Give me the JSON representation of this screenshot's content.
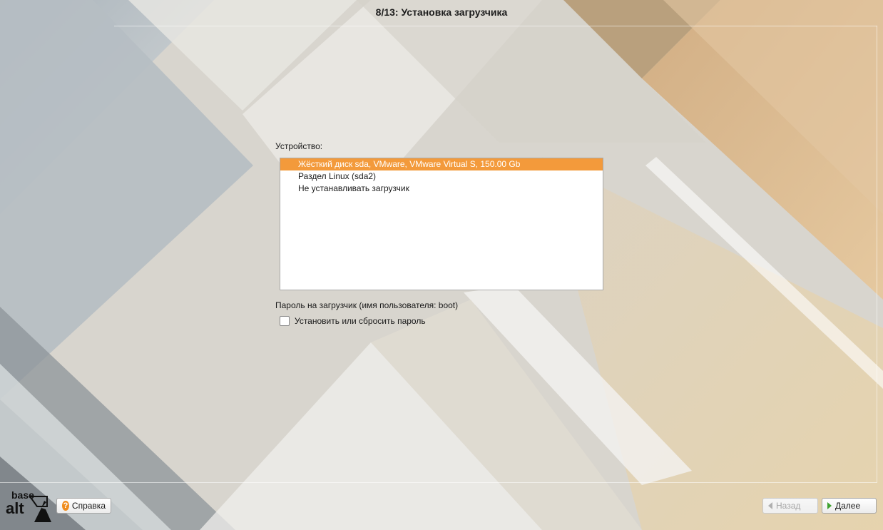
{
  "window": {
    "title": "8/13: Установка загрузчика"
  },
  "device": {
    "label": "Устройство:",
    "items": [
      {
        "label": "Жёсткий диск sda, VMware, VMware Virtual S, 150.00 Gb",
        "selected": true
      },
      {
        "label": "Раздел Linux (sda2)",
        "selected": false
      },
      {
        "label": "Не устанавливать загрузчик",
        "selected": false
      }
    ]
  },
  "password": {
    "label": "Пароль на загрузчик (имя пользователя: boot)",
    "checkbox_label": "Установить или сбросить пароль",
    "checked": false
  },
  "footer": {
    "logo_top": "base",
    "logo_bottom": "alt",
    "help_label": "Справка",
    "back_label": "Назад",
    "next_label": "Далее",
    "icons": {
      "help": "question-icon",
      "back": "arrow-left-icon",
      "next": "arrow-right-icon"
    }
  },
  "colors": {
    "selection": "#f39a3b",
    "help_icon": "#f08c1c",
    "next_arrow": "#3fa22f"
  }
}
